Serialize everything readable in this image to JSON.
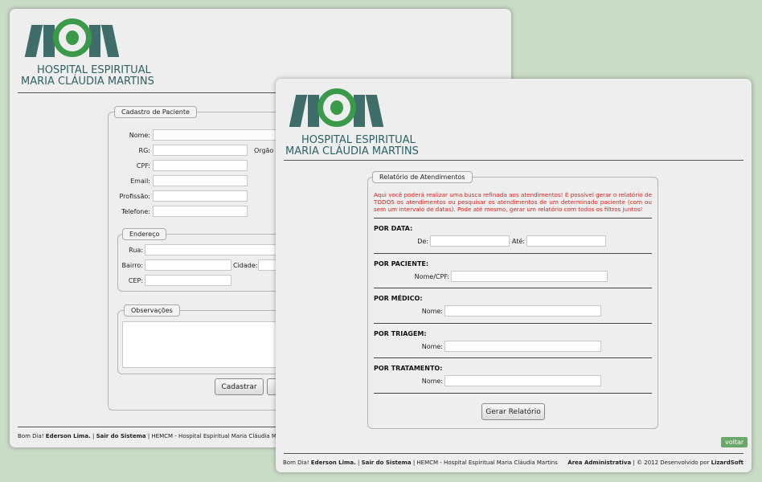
{
  "brand": {
    "line1": "HOSPITAL ESPIRITUAL",
    "line2": "MARIA CLÁUDIA MARTINS",
    "colors": {
      "bars": "#3f6d6a",
      "ring": "#3a9a4a",
      "text": "#2f6264"
    }
  },
  "back_form": {
    "legend": "Cadastro de Paciente",
    "fields": {
      "nome": "Nome:",
      "rg": "RG:",
      "orgao": "Orgão",
      "cpf": "CPF:",
      "email": "Email:",
      "profissao": "Profissão:",
      "telefone": "Telefone:"
    },
    "endereco": {
      "legend": "Endereço",
      "rua": "Rua:",
      "bairro": "Bairro:",
      "cidade": "Cidade:",
      "cep": "CEP:"
    },
    "observacoes": {
      "legend": "Observações"
    },
    "submit_label": "Cadastrar",
    "footer": {
      "greeting": "Bom Dia!",
      "user": "Ederson Lima.",
      "sep1": "|",
      "logout": "Sair do Sistema",
      "sep2": "|",
      "site": "HEMCM - Hospital Espiritual Maria Cláudia Martins"
    }
  },
  "report": {
    "legend": "Relatório de Atendimentos",
    "notice": "Aqui você poderá realizar uma busca refinada aos atendimentos! É possível gerar o relatório de TODOS os atendimentos ou pesquisar os atendimentos de um determinado paciente (com ou sem um intervalo de datas). Pode até mesmo, gerar um relatório com todos os filtros juntos!",
    "por_data": {
      "title": "POR DATA:",
      "de": "De:",
      "ate": "Até:"
    },
    "por_paciente": {
      "title": "POR PACIENTE:",
      "label": "Nome/CPF:"
    },
    "por_medico": {
      "title": "POR MÉDICO:",
      "label": "Nome:"
    },
    "por_triagem": {
      "title": "POR TRIAGEM:",
      "label": "Nome:"
    },
    "por_tratamento": {
      "title": "POR TRATAMENTO:",
      "label": "Nome:"
    },
    "button_label": "Gerar Relatório"
  },
  "front_window": {
    "voltar_label": "voltar",
    "footer": {
      "greeting": "Bom Dia!",
      "user": "Ederson Lima.",
      "sep1": "|",
      "logout": "Sair do Sistema",
      "sep2": "|",
      "site": "HEMCM - Hospital Espiritual Maria Cláudia Martins",
      "area": "Área Administrativa",
      "copyright": "| © 2012 Desenvolvido por",
      "company": "LizardSoft"
    }
  }
}
